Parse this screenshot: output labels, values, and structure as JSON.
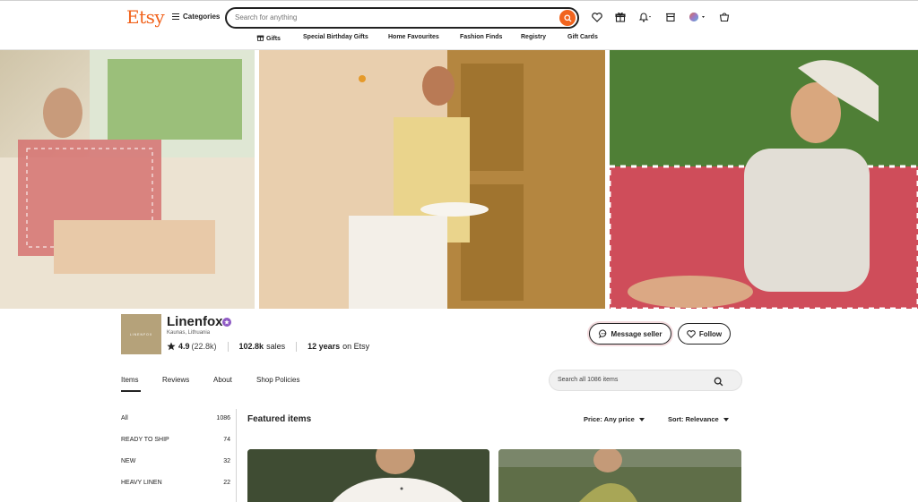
{
  "header": {
    "logo": "Etsy",
    "categories_label": "Categories",
    "search_placeholder": "Search for anything",
    "icons": [
      "heart-icon",
      "gift-icon",
      "bell-icon",
      "registry-icon",
      "avatar",
      "cart-icon"
    ]
  },
  "subnav": [
    "Gifts",
    "Special Birthday Gifts",
    "Home Favourites",
    "Fashion Finds",
    "Registry",
    "Gift Cards"
  ],
  "shop": {
    "logo_text": "LINENFOX",
    "name": "Linenfox",
    "location": "Kaunas, Lithuania",
    "rating": "4.9",
    "reviews": "(22.8k)",
    "sales_count": "102.8k",
    "sales_label": "sales",
    "years": "12 years",
    "years_suffix": "on Etsy",
    "message_label": "Message seller",
    "follow_label": "Follow"
  },
  "tabs": [
    "Items",
    "Reviews",
    "About",
    "Shop Policies"
  ],
  "shop_search_placeholder": "Search all 1086 items",
  "sidebar": [
    {
      "label": "All",
      "count": "1086"
    },
    {
      "label": "READY TO SHIP",
      "count": "74"
    },
    {
      "label": "NEW",
      "count": "32"
    },
    {
      "label": "HEAVY LINEN",
      "count": "22"
    }
  ],
  "featured": {
    "title": "Featured items",
    "price_filter": "Price: Any price",
    "sort_filter": "Sort: Relevance"
  },
  "colors": {
    "brand": "#f1641e",
    "badge": "#8e5ac4"
  }
}
